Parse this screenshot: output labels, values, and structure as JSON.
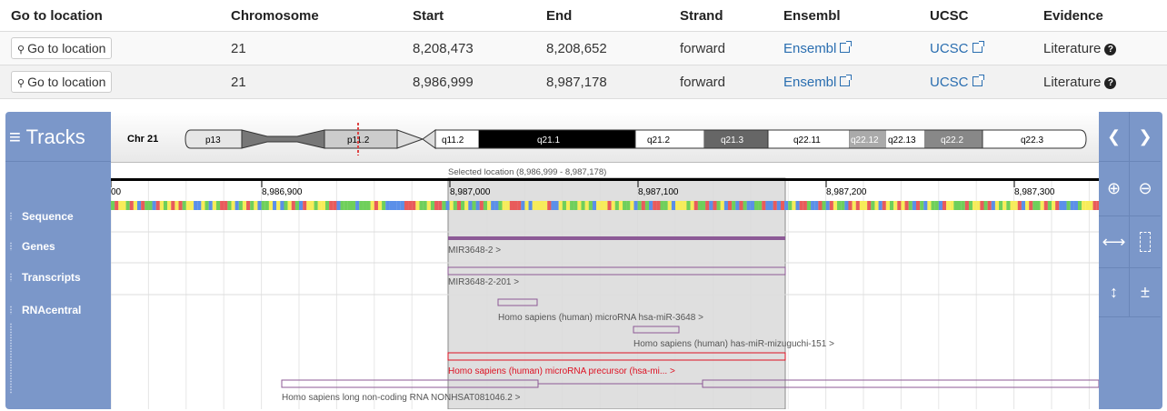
{
  "table": {
    "headers": [
      "Go to location",
      "Chromosome",
      "Start",
      "End",
      "Strand",
      "Ensembl",
      "UCSC",
      "Evidence"
    ],
    "rows": [
      {
        "goto": "Go to location",
        "chromosome": "21",
        "start": "8,208,473",
        "end": "8,208,652",
        "strand": "forward",
        "ensembl": "Ensembl",
        "ucsc": "UCSC",
        "evidence": "Literature"
      },
      {
        "goto": "Go to location",
        "chromosome": "21",
        "start": "8,986,999",
        "end": "8,987,178",
        "strand": "forward",
        "ensembl": "Ensembl",
        "ucsc": "UCSC",
        "evidence": "Literature"
      }
    ]
  },
  "browser": {
    "tracks_title": "Tracks",
    "track_labels": [
      "Sequence",
      "Genes",
      "Transcripts",
      "RNAcentral"
    ],
    "chromosome_label": "Chr 21",
    "bands": [
      "p13",
      "p11.2",
      "q11.2",
      "q21.1",
      "q21.2",
      "q21.3",
      "q22.11",
      "q22.12",
      "q22.13",
      "q22.2",
      "q22.3"
    ],
    "selected_location": "Selected location (8,986,999 - 8,987,178)",
    "ruler_ticks": [
      "00",
      "8,986,900",
      "8,987,000",
      "8,987,100",
      "8,987,200",
      "8,987,300"
    ],
    "gene": "MIR3648-2 >",
    "transcript": "MIR3648-2-201 >",
    "features": [
      "Homo sapiens (human) microRNA hsa-miR-3648 >",
      "Homo sapiens (human) has-miR-mizuguchi-151 >",
      "Homo sapiens (human) microRNA precursor (hsa-mi... >",
      "Homo sapiens long non-coding RNA NONHSAT081046.2 >"
    ],
    "colors": {
      "panel": "#7b97c9",
      "link": "#2a6eb0",
      "highlight": "#dd1122"
    }
  }
}
